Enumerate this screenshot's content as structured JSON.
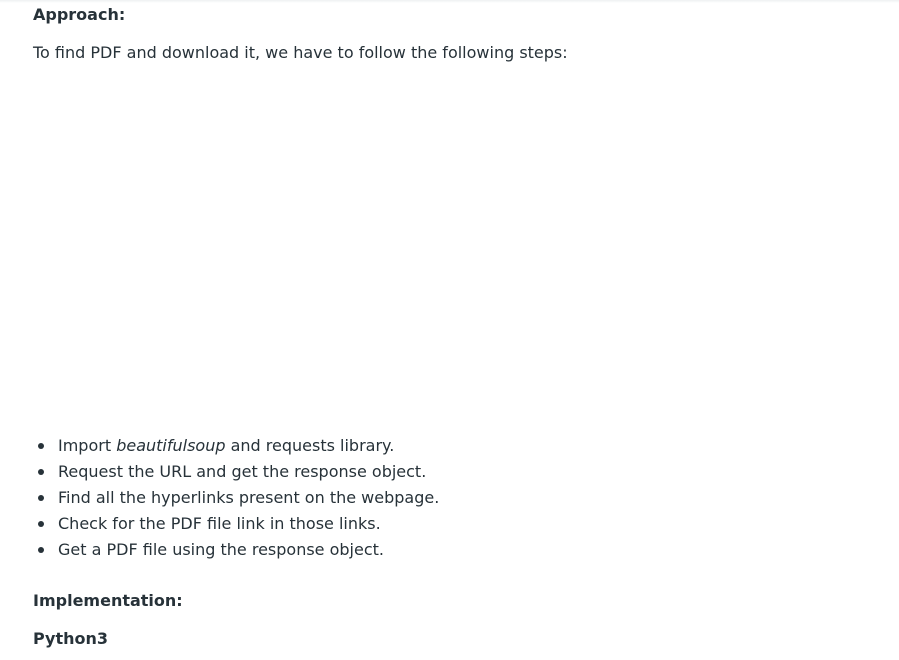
{
  "approach": {
    "heading": "Approach:",
    "intro": "To find PDF and download it, we have to follow the following steps:"
  },
  "steps": [
    {
      "before": "Import ",
      "emph": "beautifulsoup",
      "after": " and requests library."
    },
    {
      "text": "Request the URL and get the response object."
    },
    {
      "text": "Find all the hyperlinks present on the webpage."
    },
    {
      "text": "Check for the PDF file link in those links."
    },
    {
      "text": "Get a PDF file using the response object."
    }
  ],
  "implementation": {
    "heading": "Implementation:",
    "language_label": "Python3"
  },
  "colors": {
    "text": "#273239",
    "background": "#ffffff"
  }
}
